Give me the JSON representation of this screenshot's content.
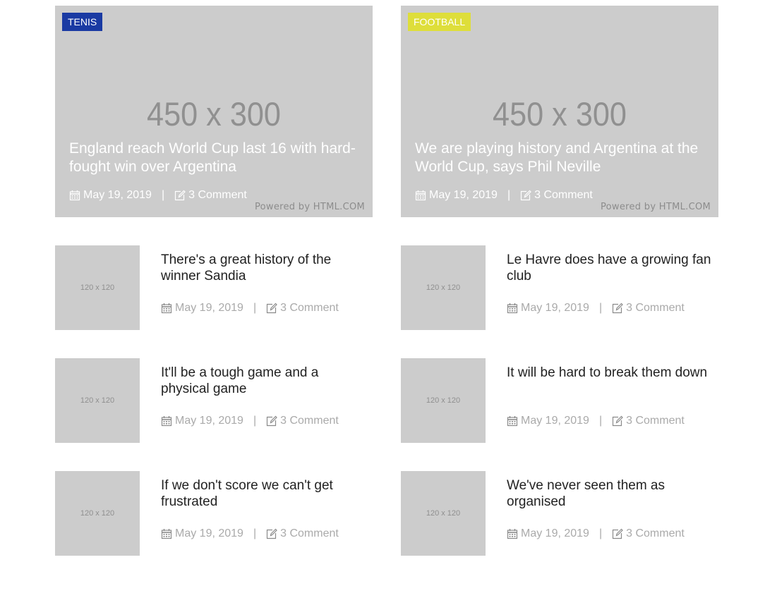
{
  "colors": {
    "placeholder_bg": "#cccccc",
    "tenis_badge": "#1a3aa3",
    "football_badge": "#dede3a"
  },
  "features": [
    {
      "badge": "TENIS",
      "badge_color": "#1a3aa3",
      "placeholder": "450 x 300",
      "headline": "England reach World Cup last 16 with hard-fought win over Argentina",
      "date": "May 19, 2019",
      "separator": "|",
      "comments": "3 Comment",
      "powered": "Powered by HTML.COM"
    },
    {
      "badge": "FOOTBALL",
      "badge_color": "#dede3a",
      "placeholder": "450 x 300",
      "headline": "We are playing history and Argentina at the World Cup, says Phil Neville",
      "date": "May 19, 2019",
      "separator": "|",
      "comments": "3 Comment",
      "powered": "Powered by HTML.COM"
    }
  ],
  "left_items": [
    {
      "placeholder": "120 x 120",
      "title": "There's a great history of the winner Sandia",
      "date": "May 19, 2019",
      "separator": "|",
      "comments": "3 Comment"
    },
    {
      "placeholder": "120 x 120",
      "title": "It'll be a tough game and a physical game",
      "date": "May 19, 2019",
      "separator": "|",
      "comments": "3 Comment"
    },
    {
      "placeholder": "120 x 120",
      "title": "If we don't score we can't get frustrated",
      "date": "May 19, 2019",
      "separator": "|",
      "comments": "3 Comment"
    }
  ],
  "right_items": [
    {
      "placeholder": "120 x 120",
      "title": "Le Havre does have a growing fan club",
      "date": "May 19, 2019",
      "separator": "|",
      "comments": "3 Comment"
    },
    {
      "placeholder": "120 x 120",
      "title": "It will be hard to break them down",
      "date": "May 19, 2019",
      "separator": "|",
      "comments": "3 Comment"
    },
    {
      "placeholder": "120 x 120",
      "title": "We've never seen them as organised",
      "date": "May 19, 2019",
      "separator": "|",
      "comments": "3 Comment"
    }
  ],
  "icons": {
    "date": "calendar-icon",
    "comments": "edit-icon"
  }
}
